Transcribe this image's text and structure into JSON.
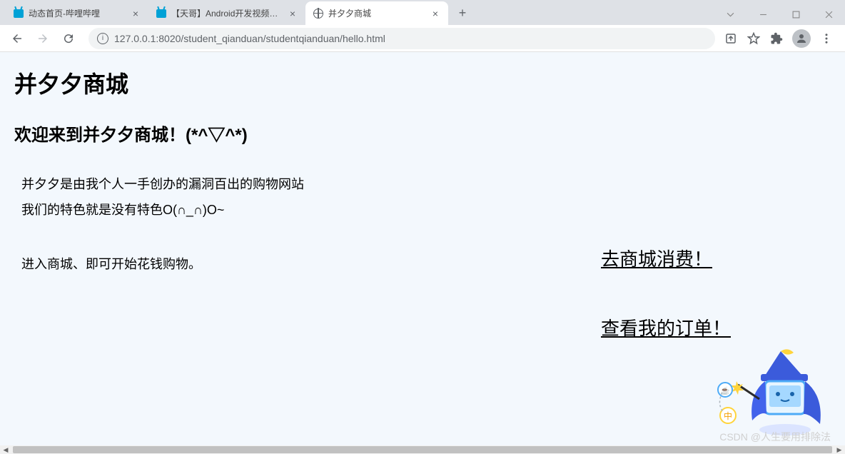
{
  "browser": {
    "tabs": [
      {
        "title": "动态首页-哔哩哔哩",
        "favicon": "bilibili"
      },
      {
        "title": "【天哥】Android开发视频教程",
        "favicon": "bilibili"
      },
      {
        "title": "并夕夕商城",
        "favicon": "globe",
        "active": true
      }
    ],
    "url": "127.0.0.1:8020/student_qianduan/studentqianduan/hello.html"
  },
  "page": {
    "h1": "并夕夕商城",
    "h2": "欢迎来到并夕夕商城！(*^▽^*)",
    "p1": "并夕夕是由我个人一手创办的漏洞百出的购物网站",
    "p2": "我们的特色就是没有特色O(∩_∩)O~",
    "p3": "进入商城、即可开始花钱购物。",
    "link1": "去商城消费！",
    "link2": "查看我的订单！"
  },
  "watermark": "CSDN @人生要用排除法"
}
